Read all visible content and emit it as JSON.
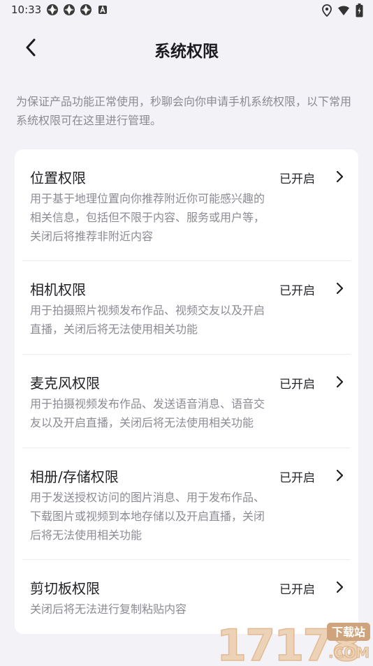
{
  "status_bar": {
    "time": "10:33",
    "left_icons": [
      "app-icon",
      "app-icon",
      "app-icon",
      "a-letter-icon"
    ],
    "right_icons": [
      "location-icon",
      "wifi-icon",
      "battery-icon"
    ]
  },
  "header": {
    "title": "系统权限"
  },
  "intro": "为保证产品功能正常使用，秒聊会向你申请手机系统权限，以下常用系统权限可在这里进行管理。",
  "permissions": [
    {
      "title": "位置权限",
      "status": "已开启",
      "desc_lines": [
        "用于基于地理位置向你推荐附近你可能感兴趣的",
        "相关信息，包括但不限于内容、服务或用户等，",
        "关闭后将推荐非附近内容"
      ]
    },
    {
      "title": "相机权限",
      "status": "已开启",
      "desc_lines": [
        "用于拍摄照片视频发布作品、视频交友以及开启",
        "直播，关闭后将无法使用相关功能"
      ]
    },
    {
      "title": "麦克风权限",
      "status": "已开启",
      "desc_lines": [
        "用于拍摄视频发布作品、发送语音消息、语音交",
        "友以及开启直播，关闭后将无法使用相关功能"
      ]
    },
    {
      "title": "相册/存储权限",
      "status": "已开启",
      "desc_lines": [
        "用于发送授权访问的图片消息、用于发布作品、",
        "下载图片或视频到本地存储以及开启直播，关闭",
        "后将无法使用相关功能"
      ]
    },
    {
      "title": "剪切板权限",
      "status": "已开启",
      "desc_lines": [
        "关闭后将无法进行复制粘贴内容"
      ]
    }
  ],
  "watermark": {
    "digits": "17178",
    "tag": "下载站",
    "domain": ".COM"
  },
  "colors": {
    "background": "#f3f3f7",
    "card": "#ffffff",
    "text_primary": "#1f1f24",
    "text_secondary": "#8b8b94",
    "watermark": "#e8c7a6"
  }
}
